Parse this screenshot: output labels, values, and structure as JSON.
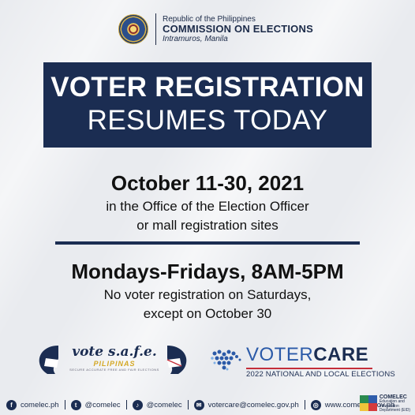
{
  "header": {
    "seal_icon": "comelec-seal-icon",
    "republic": "Republic of the Philippines",
    "commission": "COMMISSION ON ELECTIONS",
    "location": "Intramuros, Manila"
  },
  "banner": {
    "line1": "VOTER REGISTRATION",
    "line2": "RESUMES TODAY"
  },
  "dates": {
    "title": "October 11-30, 2021",
    "line1": "in the Office of the Election Officer",
    "line2": "or mall registration sites"
  },
  "hours": {
    "title": "Mondays-Fridays, 8AM-5PM",
    "line1": "No voter registration on Saturdays,",
    "line2": "except on October 30"
  },
  "logos": {
    "vote_safe": {
      "main": "vote s.a.f.e.",
      "sub": "PILIPINAS",
      "tagline": "SECURE ACCURATE FREE AND FAIR ELECTIONS"
    },
    "votercare": {
      "title_part1": "VOTER",
      "title_part2": "CARE",
      "subtitle": "2022 NATIONAL AND LOCAL ELECTIONS"
    }
  },
  "footer": {
    "items": [
      {
        "icon": "facebook-icon",
        "glyph": "f",
        "text": "comelec.ph"
      },
      {
        "icon": "twitter-icon",
        "glyph": "t",
        "text": "@comelec"
      },
      {
        "icon": "tiktok-icon",
        "glyph": "♪",
        "text": "@comelec"
      },
      {
        "icon": "email-icon",
        "glyph": "✉",
        "text": "votercare@comelec.gov.ph"
      },
      {
        "icon": "globe-icon",
        "glyph": "◎",
        "text": "www.comelec.gov.ph"
      }
    ],
    "ced": {
      "title": "COMELEC",
      "lines": [
        "Education and",
        "Information",
        "Department (EID)"
      ]
    }
  },
  "colors": {
    "navy": "#1b2d52",
    "background": "#e9ebef",
    "gold": "#d4a825",
    "blue": "#2b5aa8",
    "red": "#c42e3a"
  }
}
